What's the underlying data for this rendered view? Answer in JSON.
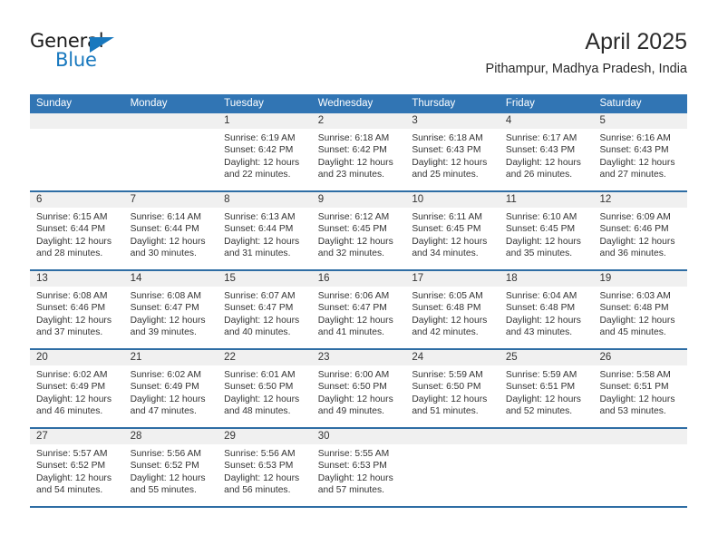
{
  "brand": {
    "name_part1": "General",
    "name_part2": "Blue",
    "triangle_icon": "triangle-icon",
    "accent_color": "#1878be"
  },
  "header": {
    "title": "April 2025",
    "subtitle": "Pithampur, Madhya Pradesh, India"
  },
  "colors": {
    "header_blue": "#3175b4",
    "row_divider_blue": "#2e6da4",
    "day_band_gray": "#f0f0f0"
  },
  "weekdays": [
    "Sunday",
    "Monday",
    "Tuesday",
    "Wednesday",
    "Thursday",
    "Friday",
    "Saturday"
  ],
  "weeks": [
    [
      {
        "day": "",
        "empty": true
      },
      {
        "day": "",
        "empty": true
      },
      {
        "day": "1",
        "sunrise": "Sunrise: 6:19 AM",
        "sunset": "Sunset: 6:42 PM",
        "daylight": "Daylight: 12 hours and 22 minutes."
      },
      {
        "day": "2",
        "sunrise": "Sunrise: 6:18 AM",
        "sunset": "Sunset: 6:42 PM",
        "daylight": "Daylight: 12 hours and 23 minutes."
      },
      {
        "day": "3",
        "sunrise": "Sunrise: 6:18 AM",
        "sunset": "Sunset: 6:43 PM",
        "daylight": "Daylight: 12 hours and 25 minutes."
      },
      {
        "day": "4",
        "sunrise": "Sunrise: 6:17 AM",
        "sunset": "Sunset: 6:43 PM",
        "daylight": "Daylight: 12 hours and 26 minutes."
      },
      {
        "day": "5",
        "sunrise": "Sunrise: 6:16 AM",
        "sunset": "Sunset: 6:43 PM",
        "daylight": "Daylight: 12 hours and 27 minutes."
      }
    ],
    [
      {
        "day": "6",
        "sunrise": "Sunrise: 6:15 AM",
        "sunset": "Sunset: 6:44 PM",
        "daylight": "Daylight: 12 hours and 28 minutes."
      },
      {
        "day": "7",
        "sunrise": "Sunrise: 6:14 AM",
        "sunset": "Sunset: 6:44 PM",
        "daylight": "Daylight: 12 hours and 30 minutes."
      },
      {
        "day": "8",
        "sunrise": "Sunrise: 6:13 AM",
        "sunset": "Sunset: 6:44 PM",
        "daylight": "Daylight: 12 hours and 31 minutes."
      },
      {
        "day": "9",
        "sunrise": "Sunrise: 6:12 AM",
        "sunset": "Sunset: 6:45 PM",
        "daylight": "Daylight: 12 hours and 32 minutes."
      },
      {
        "day": "10",
        "sunrise": "Sunrise: 6:11 AM",
        "sunset": "Sunset: 6:45 PM",
        "daylight": "Daylight: 12 hours and 34 minutes."
      },
      {
        "day": "11",
        "sunrise": "Sunrise: 6:10 AM",
        "sunset": "Sunset: 6:45 PM",
        "daylight": "Daylight: 12 hours and 35 minutes."
      },
      {
        "day": "12",
        "sunrise": "Sunrise: 6:09 AM",
        "sunset": "Sunset: 6:46 PM",
        "daylight": "Daylight: 12 hours and 36 minutes."
      }
    ],
    [
      {
        "day": "13",
        "sunrise": "Sunrise: 6:08 AM",
        "sunset": "Sunset: 6:46 PM",
        "daylight": "Daylight: 12 hours and 37 minutes."
      },
      {
        "day": "14",
        "sunrise": "Sunrise: 6:08 AM",
        "sunset": "Sunset: 6:47 PM",
        "daylight": "Daylight: 12 hours and 39 minutes."
      },
      {
        "day": "15",
        "sunrise": "Sunrise: 6:07 AM",
        "sunset": "Sunset: 6:47 PM",
        "daylight": "Daylight: 12 hours and 40 minutes."
      },
      {
        "day": "16",
        "sunrise": "Sunrise: 6:06 AM",
        "sunset": "Sunset: 6:47 PM",
        "daylight": "Daylight: 12 hours and 41 minutes."
      },
      {
        "day": "17",
        "sunrise": "Sunrise: 6:05 AM",
        "sunset": "Sunset: 6:48 PM",
        "daylight": "Daylight: 12 hours and 42 minutes."
      },
      {
        "day": "18",
        "sunrise": "Sunrise: 6:04 AM",
        "sunset": "Sunset: 6:48 PM",
        "daylight": "Daylight: 12 hours and 43 minutes."
      },
      {
        "day": "19",
        "sunrise": "Sunrise: 6:03 AM",
        "sunset": "Sunset: 6:48 PM",
        "daylight": "Daylight: 12 hours and 45 minutes."
      }
    ],
    [
      {
        "day": "20",
        "sunrise": "Sunrise: 6:02 AM",
        "sunset": "Sunset: 6:49 PM",
        "daylight": "Daylight: 12 hours and 46 minutes."
      },
      {
        "day": "21",
        "sunrise": "Sunrise: 6:02 AM",
        "sunset": "Sunset: 6:49 PM",
        "daylight": "Daylight: 12 hours and 47 minutes."
      },
      {
        "day": "22",
        "sunrise": "Sunrise: 6:01 AM",
        "sunset": "Sunset: 6:50 PM",
        "daylight": "Daylight: 12 hours and 48 minutes."
      },
      {
        "day": "23",
        "sunrise": "Sunrise: 6:00 AM",
        "sunset": "Sunset: 6:50 PM",
        "daylight": "Daylight: 12 hours and 49 minutes."
      },
      {
        "day": "24",
        "sunrise": "Sunrise: 5:59 AM",
        "sunset": "Sunset: 6:50 PM",
        "daylight": "Daylight: 12 hours and 51 minutes."
      },
      {
        "day": "25",
        "sunrise": "Sunrise: 5:59 AM",
        "sunset": "Sunset: 6:51 PM",
        "daylight": "Daylight: 12 hours and 52 minutes."
      },
      {
        "day": "26",
        "sunrise": "Sunrise: 5:58 AM",
        "sunset": "Sunset: 6:51 PM",
        "daylight": "Daylight: 12 hours and 53 minutes."
      }
    ],
    [
      {
        "day": "27",
        "sunrise": "Sunrise: 5:57 AM",
        "sunset": "Sunset: 6:52 PM",
        "daylight": "Daylight: 12 hours and 54 minutes."
      },
      {
        "day": "28",
        "sunrise": "Sunrise: 5:56 AM",
        "sunset": "Sunset: 6:52 PM",
        "daylight": "Daylight: 12 hours and 55 minutes."
      },
      {
        "day": "29",
        "sunrise": "Sunrise: 5:56 AM",
        "sunset": "Sunset: 6:53 PM",
        "daylight": "Daylight: 12 hours and 56 minutes."
      },
      {
        "day": "30",
        "sunrise": "Sunrise: 5:55 AM",
        "sunset": "Sunset: 6:53 PM",
        "daylight": "Daylight: 12 hours and 57 minutes."
      },
      {
        "day": "",
        "empty": true
      },
      {
        "day": "",
        "empty": true
      },
      {
        "day": "",
        "empty": true
      }
    ]
  ]
}
